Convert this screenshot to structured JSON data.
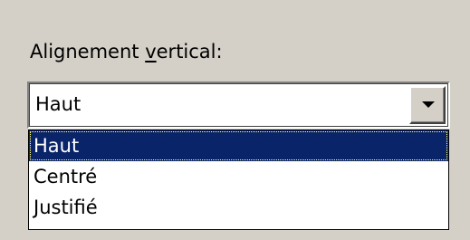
{
  "field": {
    "label_prefix": "Alignement ",
    "label_mnemonic": "v",
    "label_suffix": "ertical:"
  },
  "combobox": {
    "selected_value": "Haut",
    "button_icon": "chevron-down-icon"
  },
  "dropdown": {
    "options": [
      {
        "label": "Haut",
        "selected": true
      },
      {
        "label": "Centré",
        "selected": false
      },
      {
        "label": "Justifié",
        "selected": false
      }
    ]
  },
  "colors": {
    "dialog_background": "#d4d0c8",
    "selection_background": "#0a246a",
    "selection_text": "#ffffff"
  }
}
